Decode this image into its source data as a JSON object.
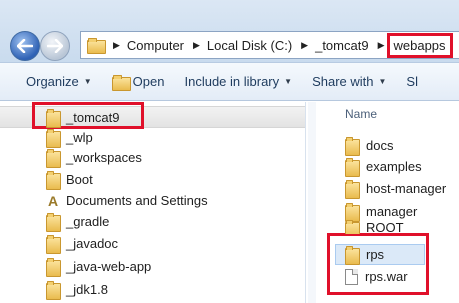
{
  "address_bar": {
    "breadcrumb": [
      "Computer",
      "Local Disk (C:)",
      "_tomcat9",
      "webapps"
    ]
  },
  "toolbar": {
    "organize": "Organize",
    "open": "Open",
    "include_in_library": "Include in library",
    "share_with": "Share with",
    "more": "Sl"
  },
  "nav_pane": {
    "items": [
      "_tomcat9",
      "_wlp",
      "_workspaces",
      "Boot",
      "Documents and Settings",
      "_gradle",
      "_javadoc",
      "_java-web-app",
      "_jdk1.8"
    ]
  },
  "file_pane": {
    "column_header": "Name",
    "items": [
      {
        "name": "docs",
        "type": "folder"
      },
      {
        "name": "examples",
        "type": "folder"
      },
      {
        "name": "host-manager",
        "type": "folder"
      },
      {
        "name": "manager",
        "type": "folder"
      },
      {
        "name": "ROOT",
        "type": "folder"
      },
      {
        "name": "rps",
        "type": "folder"
      },
      {
        "name": "rps.war",
        "type": "file"
      }
    ]
  },
  "colors": {
    "highlight": "#e0102a",
    "toolbar_text": "#1e3b5e"
  }
}
